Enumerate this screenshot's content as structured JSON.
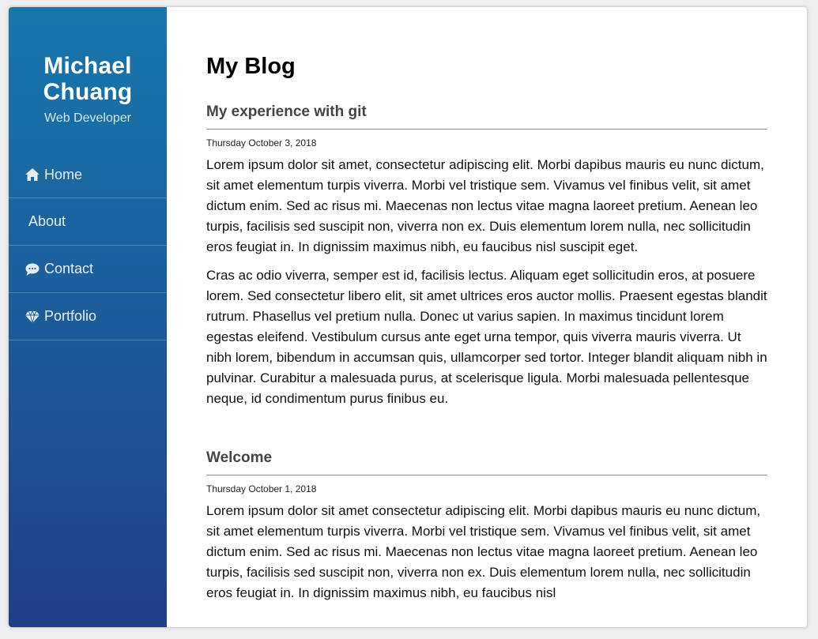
{
  "sidebar": {
    "name_line1": "Michael",
    "name_line2": "Chuang",
    "role": "Web Developer",
    "nav": [
      {
        "label": "Home",
        "icon": "home-icon"
      },
      {
        "label": "About",
        "icon": ""
      },
      {
        "label": "Contact",
        "icon": "comment-icon"
      },
      {
        "label": "Portfolio",
        "icon": "diamond-icon"
      }
    ]
  },
  "main": {
    "title": "My Blog",
    "posts": [
      {
        "title": "My experience with git",
        "date": "Thursday October 3, 2018",
        "paragraphs": [
          "Lorem ipsum dolor sit amet, consectetur adipiscing elit. Morbi dapibus mauris eu nunc dictum, sit amet elementum turpis viverra. Morbi vel tristique sem. Vivamus vel finibus velit, sit amet dictum enim. Sed ac risus mi. Maecenas non lectus vitae magna laoreet pretium. Aenean leo turpis, facilisis sed suscipit non, viverra non ex. Duis elementum lorem nulla, nec sollicitudin eros feugiat in. In dignissim maximus nibh, eu faucibus nisl suscipit eget.",
          "Cras ac odio viverra, semper est id, facilisis lectus. Aliquam eget sollicitudin eros, at posuere lorem. Sed consectetur libero elit, sit amet ultrices eros auctor mollis. Praesent egestas blandit rutrum. Phasellus vel pretium nulla. Donec ut varius sapien. In maximus tincidunt lorem egestas eleifend. Vestibulum cursus ante eget urna tempor, quis viverra mauris viverra. Ut nibh lorem, bibendum in accumsan quis, ullamcorper sed tortor. Integer blandit aliquam nibh in pulvinar. Curabitur a malesuada purus, at scelerisque ligula. Morbi malesuada pellentesque neque, id condimentum purus finibus eu."
        ]
      },
      {
        "title": "Welcome",
        "date": "Thursday October 1, 2018",
        "paragraphs": [
          "Lorem ipsum dolor sit amet consectetur adipiscing elit. Morbi dapibus mauris eu nunc dictum, sit amet elementum turpis viverra. Morbi vel tristique sem. Vivamus vel finibus velit, sit amet dictum enim. Sed ac risus mi. Maecenas non lectus vitae magna laoreet pretium. Aenean leo turpis, facilisis sed suscipit non, viverra non ex. Duis elementum lorem nulla, nec sollicitudin eros feugiat in. In dignissim maximus nibh, eu faucibus nisl"
        ]
      }
    ]
  },
  "colors": {
    "sidebar_top": "#1777ac",
    "sidebar_bottom": "#203f86",
    "text": "#111111"
  }
}
